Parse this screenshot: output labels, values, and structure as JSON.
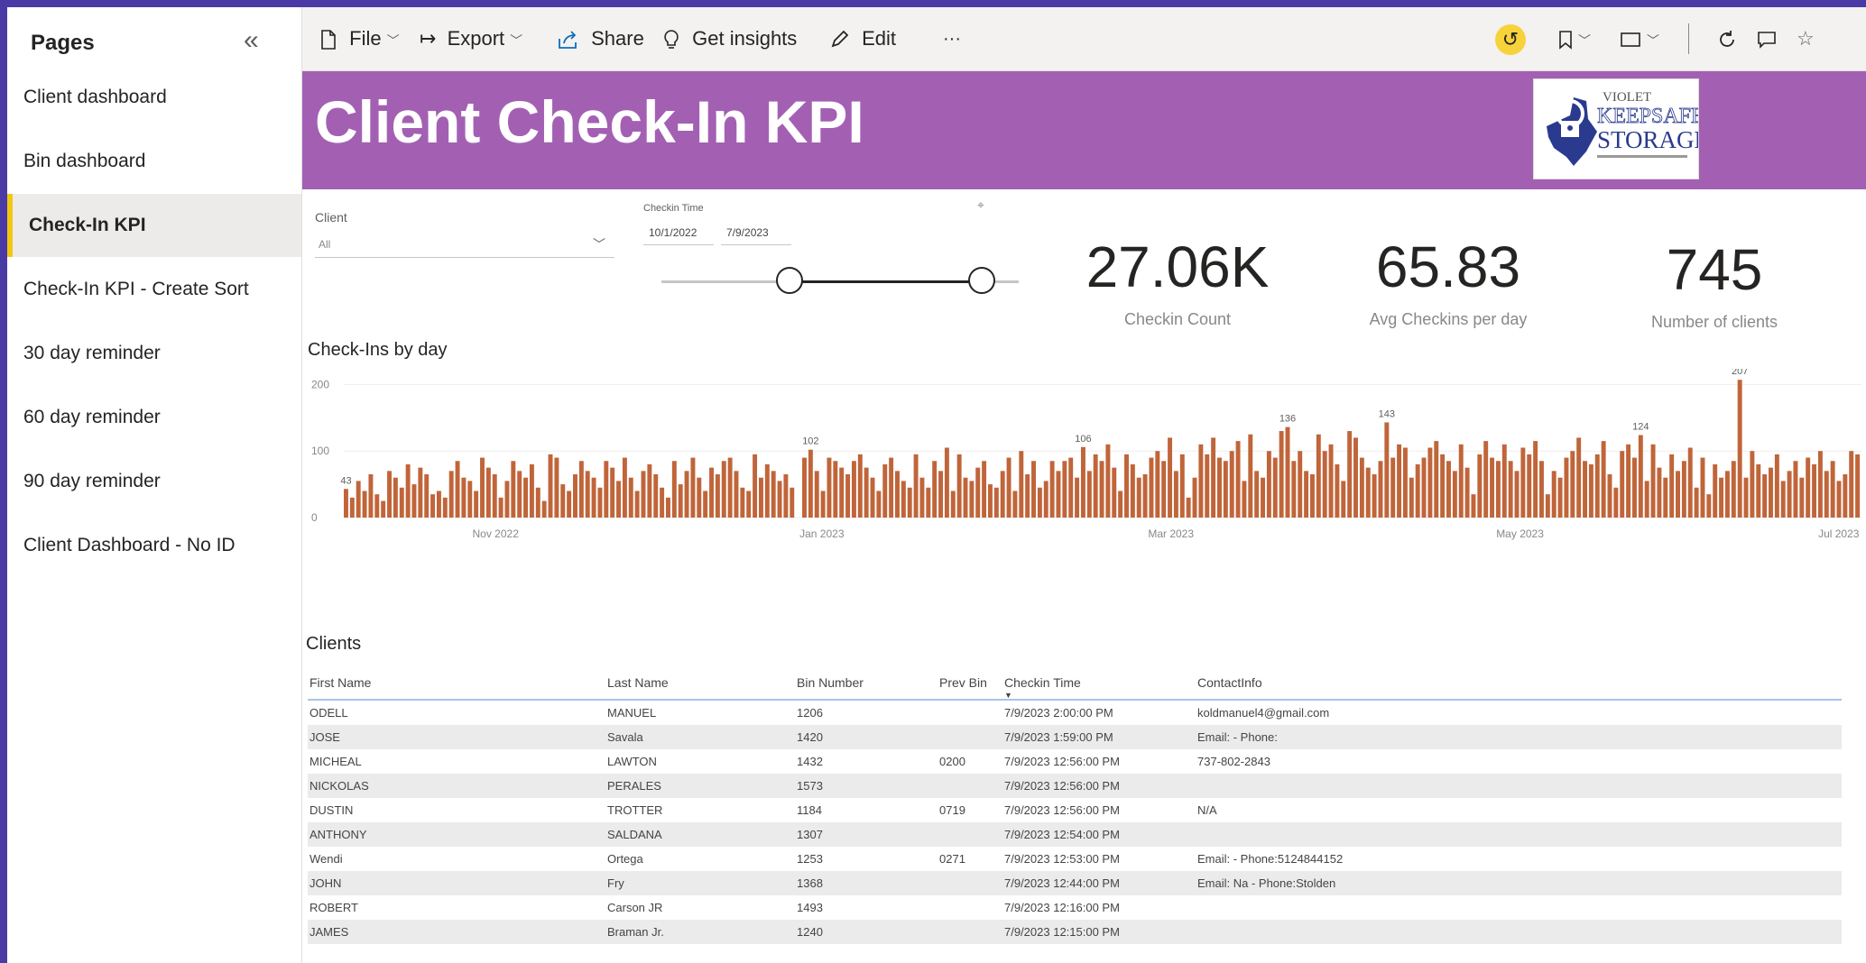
{
  "sidebar": {
    "title": "Pages",
    "items": [
      {
        "label": "Client dashboard"
      },
      {
        "label": "Bin dashboard"
      },
      {
        "label": "Check-In KPI",
        "active": true
      },
      {
        "label": "Check-In KPI - Create Sort"
      },
      {
        "label": "30 day reminder"
      },
      {
        "label": "60 day reminder"
      },
      {
        "label": "90 day reminder"
      },
      {
        "label": "Client Dashboard - No ID"
      }
    ]
  },
  "toolbar": {
    "file": "File",
    "export": "Export",
    "share": "Share",
    "insights": "Get insights",
    "edit": "Edit",
    "more": "···"
  },
  "banner": {
    "title": "Client Check-In KPI",
    "logo_line1": "VIOLET",
    "logo_line2": "KEEPSAFE",
    "logo_line3": "STORAGE",
    "accent": "#a360b3"
  },
  "filters": {
    "client_label": "Client",
    "client_value": "All",
    "time_label": "Checkin Time",
    "date_start": "10/1/2022",
    "date_end": "7/9/2023"
  },
  "kpis": [
    {
      "value": "27.06K",
      "label": "Checkin Count"
    },
    {
      "value": "65.83",
      "label": "Avg Checkins per day"
    },
    {
      "value": "745",
      "label": "Number of clients"
    }
  ],
  "chart_data": {
    "type": "bar",
    "title": "Check-Ins by day",
    "bar_color": "#c0653a",
    "ylim": [
      0,
      210
    ],
    "y_ticks": [
      0,
      100,
      200
    ],
    "x_tick_labels": [
      "Nov 2022",
      "Jan 2023",
      "Mar 2023",
      "May 2023",
      "Jul 2023"
    ],
    "data_labels": [
      "43",
      "102",
      "106",
      "136",
      "143",
      "124",
      "207"
    ],
    "values": [
      43,
      30,
      55,
      40,
      65,
      35,
      25,
      70,
      60,
      45,
      80,
      50,
      75,
      65,
      35,
      40,
      30,
      70,
      85,
      60,
      55,
      40,
      90,
      75,
      65,
      30,
      55,
      85,
      70,
      60,
      80,
      45,
      25,
      95,
      90,
      50,
      40,
      65,
      85,
      70,
      60,
      45,
      85,
      75,
      55,
      90,
      60,
      40,
      70,
      80,
      65,
      45,
      30,
      85,
      50,
      70,
      90,
      60,
      40,
      75,
      65,
      85,
      90,
      70,
      45,
      40,
      95,
      60,
      80,
      70,
      55,
      65,
      45,
      0,
      90,
      102,
      70,
      40,
      90,
      85,
      75,
      65,
      85,
      95,
      75,
      60,
      40,
      80,
      90,
      70,
      55,
      45,
      95,
      60,
      45,
      85,
      70,
      105,
      40,
      95,
      60,
      55,
      75,
      85,
      50,
      45,
      70,
      90,
      40,
      100,
      65,
      85,
      45,
      55,
      85,
      70,
      85,
      90,
      60,
      106,
      70,
      95,
      85,
      110,
      75,
      40,
      95,
      80,
      60,
      65,
      90,
      100,
      85,
      120,
      70,
      95,
      30,
      60,
      110,
      95,
      120,
      90,
      85,
      100,
      115,
      55,
      125,
      70,
      60,
      100,
      90,
      130,
      136,
      85,
      100,
      70,
      65,
      125,
      100,
      110,
      80,
      55,
      130,
      120,
      90,
      75,
      65,
      85,
      143,
      90,
      110,
      105,
      60,
      80,
      90,
      105,
      115,
      95,
      85,
      70,
      110,
      75,
      35,
      95,
      115,
      90,
      85,
      110,
      85,
      70,
      105,
      95,
      115,
      85,
      35,
      70,
      60,
      90,
      100,
      120,
      85,
      80,
      95,
      115,
      65,
      45,
      100,
      110,
      90,
      124,
      55,
      110,
      75,
      60,
      95,
      70,
      85,
      105,
      45,
      90,
      35,
      80,
      60,
      70,
      85,
      207,
      60,
      100,
      80,
      65,
      75,
      95,
      55,
      70,
      85,
      60,
      90,
      80,
      100,
      70,
      85,
      55,
      65,
      100,
      95
    ]
  },
  "clients": {
    "title": "Clients",
    "columns": [
      "First Name",
      "Last Name",
      "Bin Number",
      "Prev Bin",
      "Checkin Time",
      "ContactInfo"
    ],
    "rows": [
      [
        "ODELL",
        "MANUEL",
        "1206",
        "",
        "7/9/2023 2:00:00 PM",
        "koldmanuel4@gmail.com"
      ],
      [
        "JOSE",
        "Savala",
        "1420",
        "",
        "7/9/2023 1:59:00 PM",
        "Email: - Phone:"
      ],
      [
        "MICHEAL",
        "LAWTON",
        "1432",
        "0200",
        "7/9/2023 12:56:00 PM",
        "737-802-2843"
      ],
      [
        "NICKOLAS",
        "PERALES",
        "1573",
        "",
        "7/9/2023 12:56:00 PM",
        ""
      ],
      [
        "DUSTIN",
        "TROTTER",
        "1184",
        "0719",
        "7/9/2023 12:56:00 PM",
        "N/A"
      ],
      [
        "ANTHONY",
        "SALDANA",
        "1307",
        "",
        "7/9/2023 12:54:00 PM",
        ""
      ],
      [
        "Wendi",
        "Ortega",
        "1253",
        "0271",
        "7/9/2023 12:53:00 PM",
        "Email: - Phone:5124844152"
      ],
      [
        "JOHN",
        "Fry",
        "1368",
        "",
        "7/9/2023 12:44:00 PM",
        "Email: Na - Phone:Stolden"
      ],
      [
        "ROBERT",
        "Carson JR",
        "1493",
        "",
        "7/9/2023 12:16:00 PM",
        ""
      ],
      [
        "JAMES",
        "Braman Jr.",
        "1240",
        "",
        "7/9/2023 12:15:00 PM",
        ""
      ]
    ]
  }
}
